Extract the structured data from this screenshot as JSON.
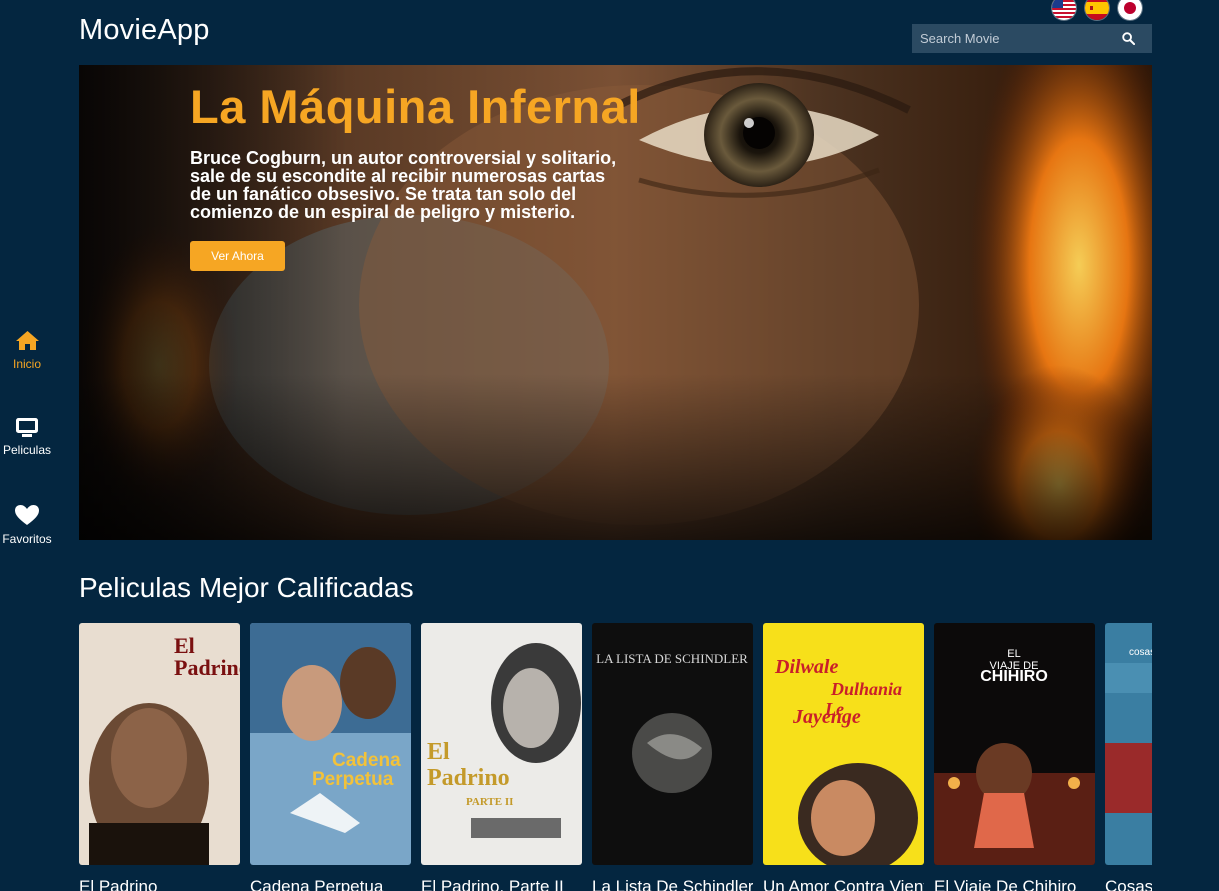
{
  "app": {
    "title": "MovieApp"
  },
  "header": {
    "languages": [
      {
        "name": "us-flag-icon"
      },
      {
        "name": "es-flag-icon"
      },
      {
        "name": "jp-flag-icon"
      }
    ],
    "search": {
      "placeholder": "Search Movie",
      "value": "",
      "icon": "search-icon"
    }
  },
  "sidebar": {
    "items": [
      {
        "label": "Inicio",
        "icon": "home-icon",
        "active": true
      },
      {
        "label": "Peliculas",
        "icon": "monitor-icon",
        "active": false
      },
      {
        "label": "Favoritos",
        "icon": "heart-icon",
        "active": false
      }
    ]
  },
  "hero": {
    "title": "La Máquina Infernal",
    "description": "Bruce Cogburn, un autor controversial y solitario, sale de su escondite al recibir numerosas cartas de un fanático obsesivo. Se trata tan solo del comienzo de un espiral de peligro y misterio.",
    "button_label": "Ver Ahora"
  },
  "section": {
    "title": "Peliculas Mejor Calificadas",
    "movies": [
      {
        "title": "El Padrino",
        "poster_text": [
          "El",
          "Padrino"
        ]
      },
      {
        "title": "Cadena Perpetua",
        "poster_text": [
          "Cadena",
          "Perpetua"
        ]
      },
      {
        "title": "El Padrino, Parte II",
        "poster_text": [
          "El",
          "Padrino",
          "PARTE II"
        ]
      },
      {
        "title": "La Lista De Schindler",
        "poster_text": [
          "LA LISTA DE SCHINDLER"
        ]
      },
      {
        "title": "Un Amor Contra Viento y Marea",
        "poster_text": [
          "Dilwale",
          "Dulhania",
          "Le",
          "Jayenge"
        ]
      },
      {
        "title": "El Viaje De Chihiro",
        "poster_text": [
          "EL",
          "VIAJE DE",
          "CHIHIRO"
        ]
      },
      {
        "title": "Cosas",
        "poster_text": [
          "cosas"
        ]
      }
    ]
  },
  "colors": {
    "background": "#042640",
    "accent": "#f6a623",
    "search_bg": "#2b4a62"
  }
}
